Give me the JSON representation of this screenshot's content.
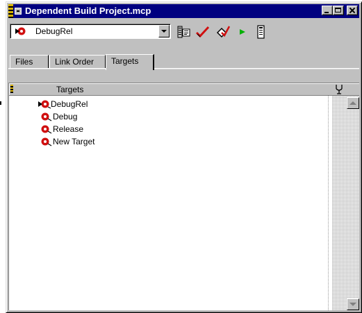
{
  "window": {
    "title": "Dependent Build Project.mcp"
  },
  "toolbar": {
    "target_select": {
      "value": "DebugRel"
    },
    "icons": [
      "target-settings-icon",
      "checkmark-icon",
      "build-icon",
      "run-icon",
      "project-inspector-icon"
    ]
  },
  "tabs": [
    {
      "label": "Files",
      "active": false
    },
    {
      "label": "Link Order",
      "active": false
    },
    {
      "label": "Targets",
      "active": true
    }
  ],
  "list": {
    "header": "Targets",
    "items": [
      {
        "label": "DebugRel",
        "icon": "target-active-icon",
        "active": true
      },
      {
        "label": "Debug",
        "icon": "target-icon",
        "active": false
      },
      {
        "label": "Release",
        "icon": "target-icon",
        "active": false
      },
      {
        "label": "New Target",
        "icon": "target-icon",
        "active": false
      }
    ]
  },
  "colors": {
    "titlebar": "#000080",
    "face": "#c0c0c0",
    "target_icon": "#d01010",
    "run_icon": "#00b000"
  }
}
